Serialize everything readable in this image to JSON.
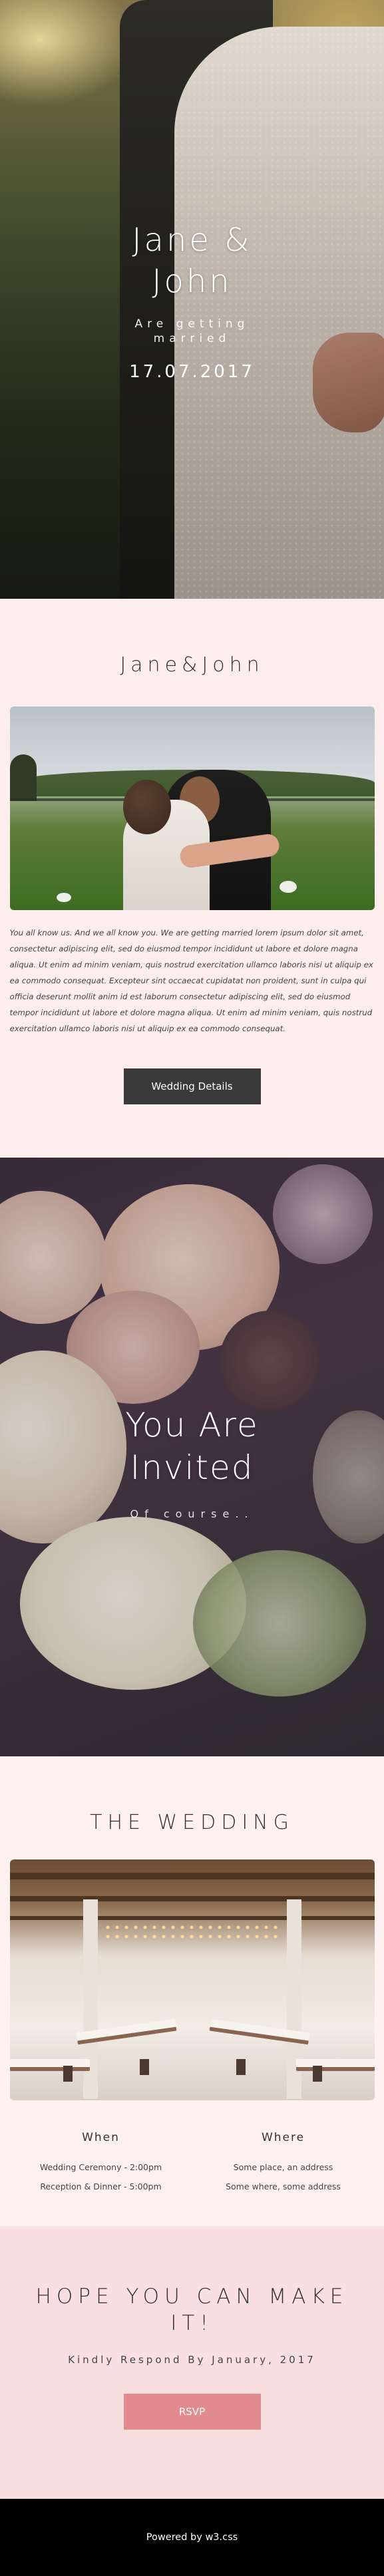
{
  "hero": {
    "title": "Jane & John",
    "subtitle": "Are getting married",
    "date": "17.07.2017"
  },
  "intro": {
    "heading": "Jane&John",
    "body": "You all know us. And we all know you. We are getting married lorem ipsum dolor sit amet, consectetur adipiscing elit, sed do eiusmod tempor incididunt ut labore et dolore magna aliqua. Ut enim ad minim veniam, quis nostrud exercitation ullamco laboris nisi ut aliquip ex ea commodo consequat. Excepteur sint occaecat cupidatat non proident, sunt in culpa qui officia deserunt mollit anim id est laborum consectetur adipiscing elit, sed do eiusmod tempor incididunt ut labore et dolore magna aliqua. Ut enim ad minim veniam, quis nostrud exercitation ullamco laboris nisi ut aliquip ex ea commodo consequat.",
    "button_label": "Wedding Details"
  },
  "invite": {
    "title": "You Are Invited",
    "subtitle": "Of course.."
  },
  "wedding": {
    "heading": "THE WEDDING",
    "when": {
      "title": "When",
      "lines": [
        "Wedding Ceremony - 2:00pm",
        "Reception & Dinner - 5:00pm"
      ]
    },
    "where": {
      "title": "Where",
      "lines": [
        "Some place, an address",
        "Some where, some address"
      ]
    }
  },
  "rsvp": {
    "heading": "HOPE YOU CAN MAKE IT!",
    "subtitle": "Kindly Respond By January, 2017",
    "button_label": "RSVP"
  },
  "footer": {
    "prefix": "Powered by ",
    "link_text": "w3.css"
  },
  "colors": {
    "intro_bg": "#fdeeed",
    "wedding_bg": "#fff1f1",
    "rsvp_bg": "#fadfe0",
    "dark_button": "#3a3a3a",
    "rsvp_button": "#e28b8f",
    "footer_bg": "#000000"
  }
}
